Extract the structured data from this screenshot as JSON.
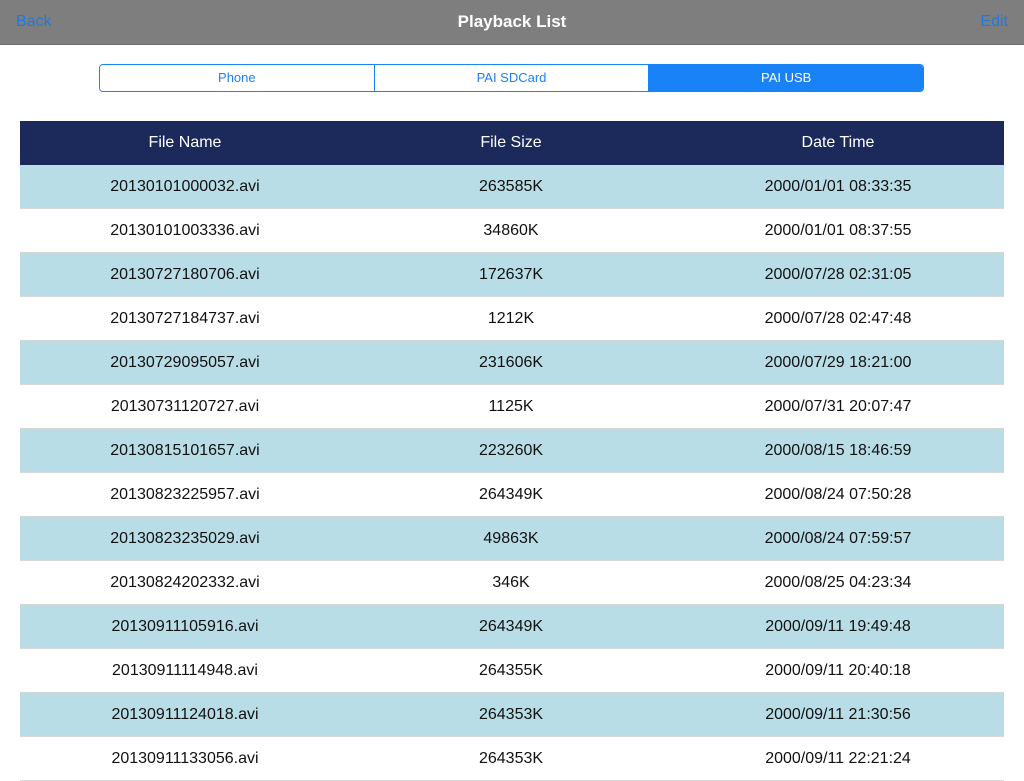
{
  "navbar": {
    "back_label": "Back",
    "title": "Playback List",
    "edit_label": "Edit"
  },
  "segments": [
    {
      "label": "Phone",
      "selected": false
    },
    {
      "label": "PAI SDCard",
      "selected": false
    },
    {
      "label": "PAI USB",
      "selected": true
    }
  ],
  "table": {
    "headers": [
      "File Name",
      "File Size",
      "Date Time"
    ],
    "rows": [
      {
        "name": "20130101000032.avi",
        "size": "263585K",
        "date": "2000/01/01 08:33:35"
      },
      {
        "name": "20130101003336.avi",
        "size": "34860K",
        "date": "2000/01/01 08:37:55"
      },
      {
        "name": "20130727180706.avi",
        "size": "172637K",
        "date": "2000/07/28 02:31:05"
      },
      {
        "name": "20130727184737.avi",
        "size": "1212K",
        "date": "2000/07/28 02:47:48"
      },
      {
        "name": "20130729095057.avi",
        "size": "231606K",
        "date": "2000/07/29 18:21:00"
      },
      {
        "name": "20130731120727.avi",
        "size": "1125K",
        "date": "2000/07/31 20:07:47"
      },
      {
        "name": "20130815101657.avi",
        "size": "223260K",
        "date": "2000/08/15 18:46:59"
      },
      {
        "name": "20130823225957.avi",
        "size": "264349K",
        "date": "2000/08/24 07:50:28"
      },
      {
        "name": "20130823235029.avi",
        "size": "49863K",
        "date": "2000/08/24 07:59:57"
      },
      {
        "name": "20130824202332.avi",
        "size": "346K",
        "date": "2000/08/25 04:23:34"
      },
      {
        "name": "20130911105916.avi",
        "size": "264349K",
        "date": "2000/09/11 19:49:48"
      },
      {
        "name": "20130911114948.avi",
        "size": "264355K",
        "date": "2000/09/11 20:40:18"
      },
      {
        "name": "20130911124018.avi",
        "size": "264353K",
        "date": "2000/09/11 21:30:56"
      },
      {
        "name": "20130911133056.avi",
        "size": "264353K",
        "date": "2000/09/11 22:21:24"
      }
    ]
  },
  "colors": {
    "navbar_bg": "#7e7e7e",
    "accent": "#1a82f7",
    "header_bg": "#1b2a5a",
    "row_alt_bg": "#b8dde6"
  }
}
